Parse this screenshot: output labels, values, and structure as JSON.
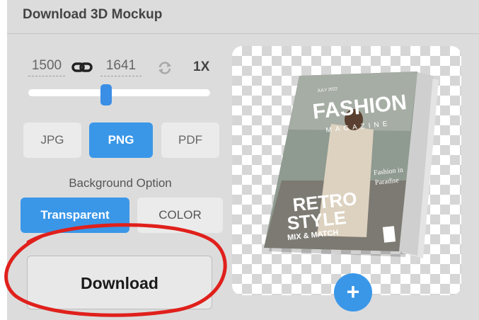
{
  "panel": {
    "title": "Download 3D Mockup"
  },
  "size": {
    "width": "1500",
    "height": "1641",
    "scale": "1X"
  },
  "slider": {
    "value_fraction": 0.42
  },
  "formats": [
    {
      "label": "JPG",
      "selected": false
    },
    {
      "label": "PNG",
      "selected": true
    },
    {
      "label": "PDF",
      "selected": false
    }
  ],
  "background": {
    "label": "Background Option",
    "options": [
      {
        "label": "Transparent",
        "selected": true
      },
      {
        "label": "COLOR",
        "selected": false
      }
    ]
  },
  "download": {
    "label": "Download"
  },
  "preview": {
    "magazine": {
      "masthead": "FASHION",
      "subtitle": "MAGAZINE",
      "headline_line1": "RETRO",
      "headline_line2": "STYLE",
      "tagline": "MIX & MATCH",
      "side_text_line1": "Fashion in",
      "side_text_line2": "Paradise",
      "issue": "JULY 2022"
    },
    "add_label": "+"
  },
  "colors": {
    "accent": "#3a97e8",
    "annotation": "#e0201c"
  }
}
